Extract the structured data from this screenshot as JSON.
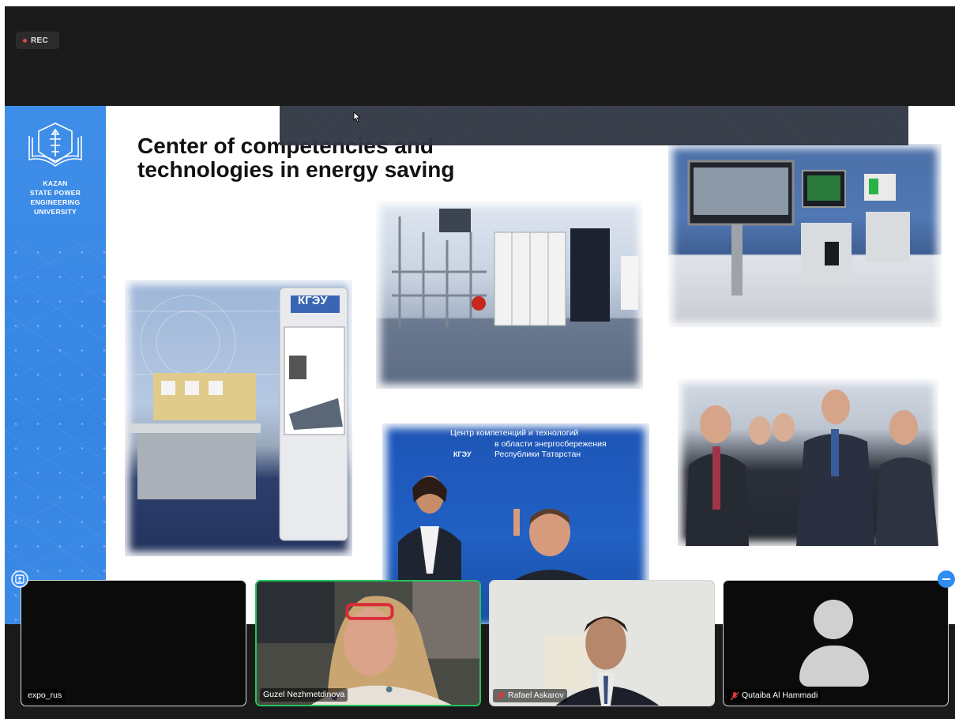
{
  "recording": {
    "label": "REC"
  },
  "slide": {
    "university_lines": [
      "Kazan",
      "State Power",
      "Engineering",
      "University"
    ],
    "title_line1": "Center of competencies and",
    "title_line2": "technologies in energy saving",
    "kiosk_brand": "КГЭУ",
    "banner_line1": "Центр компетенций и технологий",
    "banner_line2": "в области энергосбережения",
    "banner_line3": "Республики Татарстан",
    "banner_brand": "КГЭУ"
  },
  "participants": [
    {
      "name": "expo_rus",
      "muted": false,
      "video": false,
      "avatar": false
    },
    {
      "name": "Guzel Nezhmetdinova",
      "muted": false,
      "video": true,
      "active_speaker": true
    },
    {
      "name": "Rafael Askarov",
      "muted": true,
      "video": true
    },
    {
      "name": "Qutaiba Al Hammadi",
      "muted": true,
      "video": false,
      "avatar": true
    }
  ],
  "icons": {
    "gallery_toggle": "person-square-icon",
    "minimize": "minus-circle-icon",
    "cursor": "mouse-pointer-icon",
    "mic_off": "mic-off-icon"
  },
  "colors": {
    "slide_sidebar": "#3f8ee9",
    "active_speaker_border": "#23c45d",
    "rec_dot": "#e04848",
    "accent_button": "#2f8cf2"
  }
}
